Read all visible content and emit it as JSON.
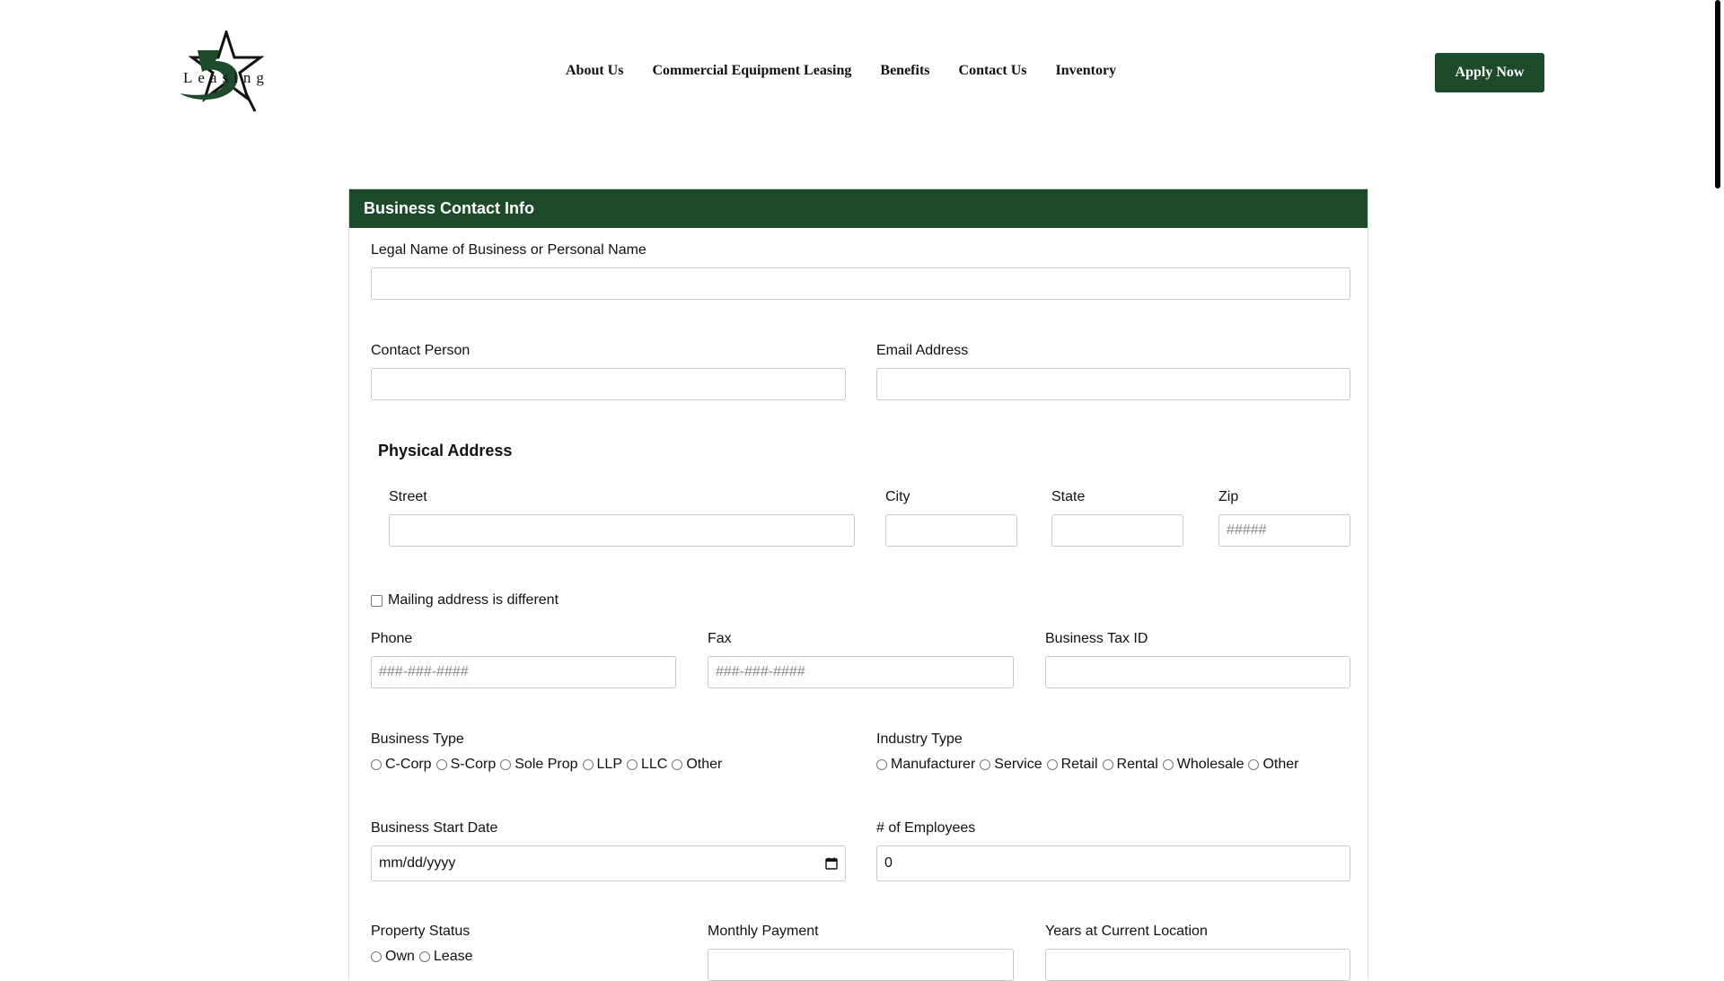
{
  "header": {
    "logo_text": "Leasing",
    "nav": [
      "About Us",
      "Commercial Equipment Leasing",
      "Benefits",
      "Contact Us",
      "Inventory"
    ],
    "apply_label": "Apply Now"
  },
  "form": {
    "section_title": "Business Contact Info",
    "legal_name": {
      "label": "Legal Name of Business or Personal Name",
      "value": ""
    },
    "contact_person": {
      "label": "Contact Person",
      "value": ""
    },
    "email": {
      "label": "Email Address",
      "value": ""
    },
    "physical_address": {
      "title": "Physical Address",
      "street": {
        "label": "Street",
        "value": ""
      },
      "city": {
        "label": "City",
        "value": ""
      },
      "state": {
        "label": "State",
        "value": ""
      },
      "zip": {
        "label": "Zip",
        "placeholder": "#####"
      }
    },
    "mailing_different": {
      "label": "Mailing address is different",
      "checked": false
    },
    "phone": {
      "label": "Phone",
      "placeholder": "###-###-####"
    },
    "fax": {
      "label": "Fax",
      "placeholder": "###-###-####"
    },
    "tax_id": {
      "label": "Business Tax ID",
      "value": ""
    },
    "business_type": {
      "label": "Business Type",
      "options": [
        "C-Corp",
        "S-Corp",
        "Sole Prop",
        "LLP",
        "LLC",
        "Other"
      ]
    },
    "industry_type": {
      "label": "Industry Type",
      "options": [
        "Manufacturer",
        "Service",
        "Retail",
        "Rental",
        "Wholesale",
        "Other"
      ]
    },
    "start_date": {
      "label": "Business Start Date",
      "placeholder": "mm/dd/yyyy"
    },
    "employees": {
      "label": "# of Employees",
      "value": "0"
    },
    "property_status": {
      "label": "Property Status",
      "options": [
        "Own",
        "Lease"
      ]
    },
    "monthly_payment": {
      "label": "Monthly Payment",
      "value": ""
    },
    "years_location": {
      "label": "Years at Current Location",
      "value": ""
    }
  },
  "colors": {
    "brand_green": "#1c4a2a"
  }
}
